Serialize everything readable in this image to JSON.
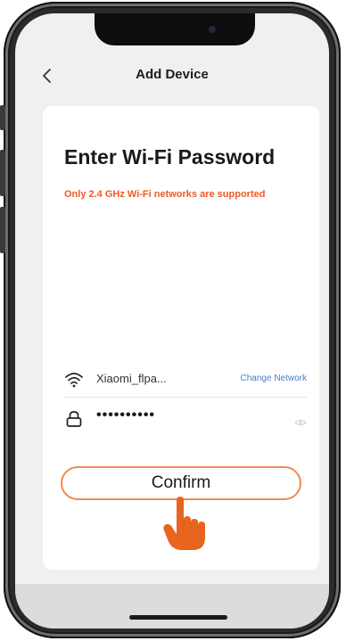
{
  "nav": {
    "title": "Add Device",
    "back_icon": "chevron-left-icon"
  },
  "content": {
    "heading": "Enter Wi-Fi Password",
    "notice": "Only 2.4 GHz Wi-Fi networks are supported",
    "notice_color": "#ee5a24"
  },
  "network": {
    "icon": "wifi-icon",
    "ssid": "Xiaomi_flpa...",
    "change_label": "Change Network"
  },
  "password": {
    "icon": "lock-icon",
    "value": "••••••••••",
    "toggle_icon": "eye-icon"
  },
  "actions": {
    "confirm_label": "Confirm",
    "confirm_border_color": "#f08a50",
    "pointer_icon": "pointing-hand-icon",
    "pointer_color": "#e8651f"
  }
}
